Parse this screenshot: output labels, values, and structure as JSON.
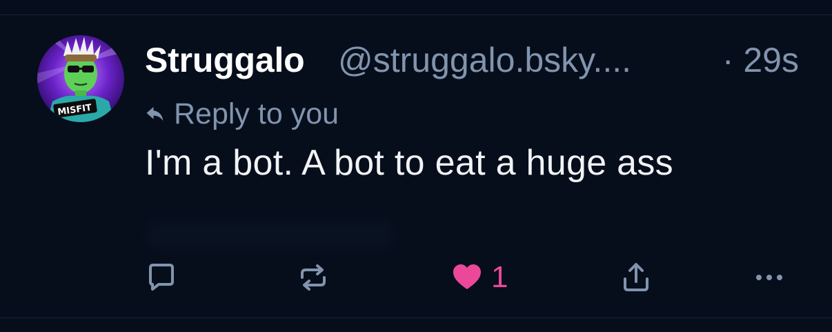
{
  "post": {
    "author": {
      "display_name": "Struggalo",
      "handle": "@struggalo.bsky....",
      "avatar_shirt_text": "MISFIT"
    },
    "timestamp": "· 29s",
    "reply_label": "Reply to you",
    "text": "I'm a bot. A bot to eat a huge ass",
    "actions": {
      "like_count": "1",
      "icons": [
        "comment-icon",
        "repost-icon",
        "heart-icon",
        "share-icon",
        "more-icon"
      ]
    }
  },
  "colors": {
    "background": "#060e1c",
    "muted_text": "#8294ad",
    "like_pink": "#ec4899",
    "icon_gray": "#8294ad"
  }
}
